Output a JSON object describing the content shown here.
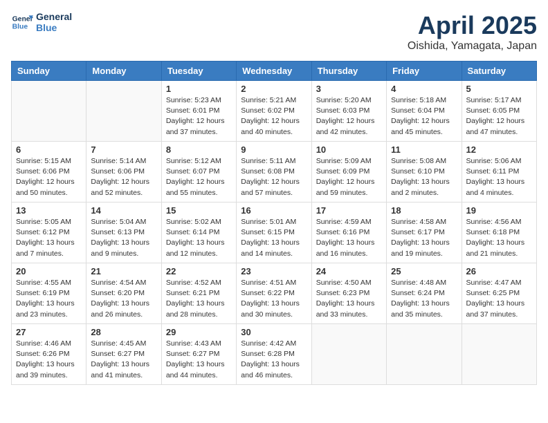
{
  "header": {
    "logo_line1": "General",
    "logo_line2": "Blue",
    "month": "April 2025",
    "location": "Oishida, Yamagata, Japan"
  },
  "weekdays": [
    "Sunday",
    "Monday",
    "Tuesday",
    "Wednesday",
    "Thursday",
    "Friday",
    "Saturday"
  ],
  "weeks": [
    [
      {
        "day": "",
        "info": ""
      },
      {
        "day": "",
        "info": ""
      },
      {
        "day": "1",
        "info": "Sunrise: 5:23 AM\nSunset: 6:01 PM\nDaylight: 12 hours and 37 minutes."
      },
      {
        "day": "2",
        "info": "Sunrise: 5:21 AM\nSunset: 6:02 PM\nDaylight: 12 hours and 40 minutes."
      },
      {
        "day": "3",
        "info": "Sunrise: 5:20 AM\nSunset: 6:03 PM\nDaylight: 12 hours and 42 minutes."
      },
      {
        "day": "4",
        "info": "Sunrise: 5:18 AM\nSunset: 6:04 PM\nDaylight: 12 hours and 45 minutes."
      },
      {
        "day": "5",
        "info": "Sunrise: 5:17 AM\nSunset: 6:05 PM\nDaylight: 12 hours and 47 minutes."
      }
    ],
    [
      {
        "day": "6",
        "info": "Sunrise: 5:15 AM\nSunset: 6:06 PM\nDaylight: 12 hours and 50 minutes."
      },
      {
        "day": "7",
        "info": "Sunrise: 5:14 AM\nSunset: 6:06 PM\nDaylight: 12 hours and 52 minutes."
      },
      {
        "day": "8",
        "info": "Sunrise: 5:12 AM\nSunset: 6:07 PM\nDaylight: 12 hours and 55 minutes."
      },
      {
        "day": "9",
        "info": "Sunrise: 5:11 AM\nSunset: 6:08 PM\nDaylight: 12 hours and 57 minutes."
      },
      {
        "day": "10",
        "info": "Sunrise: 5:09 AM\nSunset: 6:09 PM\nDaylight: 12 hours and 59 minutes."
      },
      {
        "day": "11",
        "info": "Sunrise: 5:08 AM\nSunset: 6:10 PM\nDaylight: 13 hours and 2 minutes."
      },
      {
        "day": "12",
        "info": "Sunrise: 5:06 AM\nSunset: 6:11 PM\nDaylight: 13 hours and 4 minutes."
      }
    ],
    [
      {
        "day": "13",
        "info": "Sunrise: 5:05 AM\nSunset: 6:12 PM\nDaylight: 13 hours and 7 minutes."
      },
      {
        "day": "14",
        "info": "Sunrise: 5:04 AM\nSunset: 6:13 PM\nDaylight: 13 hours and 9 minutes."
      },
      {
        "day": "15",
        "info": "Sunrise: 5:02 AM\nSunset: 6:14 PM\nDaylight: 13 hours and 12 minutes."
      },
      {
        "day": "16",
        "info": "Sunrise: 5:01 AM\nSunset: 6:15 PM\nDaylight: 13 hours and 14 minutes."
      },
      {
        "day": "17",
        "info": "Sunrise: 4:59 AM\nSunset: 6:16 PM\nDaylight: 13 hours and 16 minutes."
      },
      {
        "day": "18",
        "info": "Sunrise: 4:58 AM\nSunset: 6:17 PM\nDaylight: 13 hours and 19 minutes."
      },
      {
        "day": "19",
        "info": "Sunrise: 4:56 AM\nSunset: 6:18 PM\nDaylight: 13 hours and 21 minutes."
      }
    ],
    [
      {
        "day": "20",
        "info": "Sunrise: 4:55 AM\nSunset: 6:19 PM\nDaylight: 13 hours and 23 minutes."
      },
      {
        "day": "21",
        "info": "Sunrise: 4:54 AM\nSunset: 6:20 PM\nDaylight: 13 hours and 26 minutes."
      },
      {
        "day": "22",
        "info": "Sunrise: 4:52 AM\nSunset: 6:21 PM\nDaylight: 13 hours and 28 minutes."
      },
      {
        "day": "23",
        "info": "Sunrise: 4:51 AM\nSunset: 6:22 PM\nDaylight: 13 hours and 30 minutes."
      },
      {
        "day": "24",
        "info": "Sunrise: 4:50 AM\nSunset: 6:23 PM\nDaylight: 13 hours and 33 minutes."
      },
      {
        "day": "25",
        "info": "Sunrise: 4:48 AM\nSunset: 6:24 PM\nDaylight: 13 hours and 35 minutes."
      },
      {
        "day": "26",
        "info": "Sunrise: 4:47 AM\nSunset: 6:25 PM\nDaylight: 13 hours and 37 minutes."
      }
    ],
    [
      {
        "day": "27",
        "info": "Sunrise: 4:46 AM\nSunset: 6:26 PM\nDaylight: 13 hours and 39 minutes."
      },
      {
        "day": "28",
        "info": "Sunrise: 4:45 AM\nSunset: 6:27 PM\nDaylight: 13 hours and 41 minutes."
      },
      {
        "day": "29",
        "info": "Sunrise: 4:43 AM\nSunset: 6:27 PM\nDaylight: 13 hours and 44 minutes."
      },
      {
        "day": "30",
        "info": "Sunrise: 4:42 AM\nSunset: 6:28 PM\nDaylight: 13 hours and 46 minutes."
      },
      {
        "day": "",
        "info": ""
      },
      {
        "day": "",
        "info": ""
      },
      {
        "day": "",
        "info": ""
      }
    ]
  ]
}
